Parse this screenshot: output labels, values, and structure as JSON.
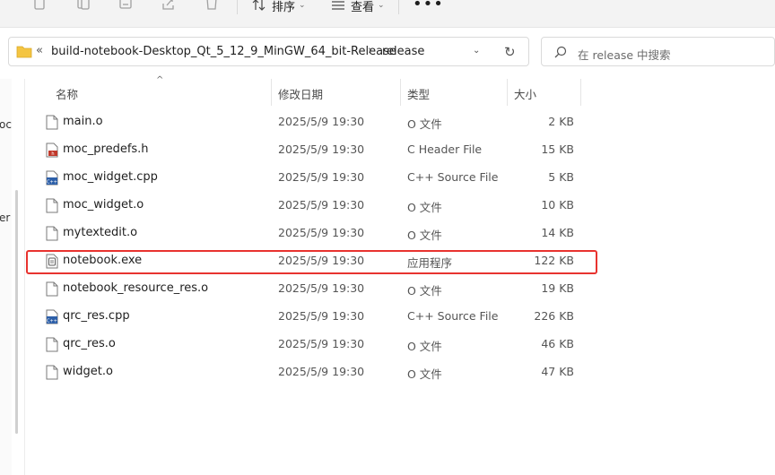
{
  "toolbar": {
    "sort_label": "排序",
    "view_label": "查看",
    "more_label": "•••"
  },
  "address": {
    "chevrons": "«",
    "folder": "build-notebook-Desktop_Qt_5_12_9_MinGW_64_bit-Release",
    "separator": "›",
    "current": "release"
  },
  "search": {
    "placeholder": "在 release 中搜索"
  },
  "left_pane": {
    "fragment_1": "oc",
    "fragment_2": "er"
  },
  "columns": {
    "name": "名称",
    "date": "修改日期",
    "type": "类型",
    "size": "大小"
  },
  "files": [
    {
      "name": "main.o",
      "date": "2025/5/9 19:30",
      "type": "O 文件",
      "size": "2 KB",
      "icon": "generic-file-icon"
    },
    {
      "name": "moc_predefs.h",
      "date": "2025/5/9 19:30",
      "type": "C Header File",
      "size": "15 KB",
      "icon": "c-header-file-icon"
    },
    {
      "name": "moc_widget.cpp",
      "date": "2025/5/9 19:30",
      "type": "C++ Source File",
      "size": "5 KB",
      "icon": "cpp-source-file-icon"
    },
    {
      "name": "moc_widget.o",
      "date": "2025/5/9 19:30",
      "type": "O 文件",
      "size": "10 KB",
      "icon": "generic-file-icon"
    },
    {
      "name": "mytextedit.o",
      "date": "2025/5/9 19:30",
      "type": "O 文件",
      "size": "14 KB",
      "icon": "generic-file-icon"
    },
    {
      "name": "notebook.exe",
      "date": "2025/5/9 19:30",
      "type": "应用程序",
      "size": "122 KB",
      "icon": "exe-file-icon"
    },
    {
      "name": "notebook_resource_res.o",
      "date": "2025/5/9 19:30",
      "type": "O 文件",
      "size": "19 KB",
      "icon": "generic-file-icon"
    },
    {
      "name": "qrc_res.cpp",
      "date": "2025/5/9 19:30",
      "type": "C++ Source File",
      "size": "226 KB",
      "icon": "cpp-source-file-icon"
    },
    {
      "name": "qrc_res.o",
      "date": "2025/5/9 19:30",
      "type": "O 文件",
      "size": "46 KB",
      "icon": "generic-file-icon"
    },
    {
      "name": "widget.o",
      "date": "2025/5/9 19:30",
      "type": "O 文件",
      "size": "47 KB",
      "icon": "generic-file-icon"
    }
  ],
  "colors": {
    "highlight": "#e8332f",
    "folder": "#f4c542",
    "cpp_icon": "#2d5fa8",
    "header_icon": "#c0392b"
  }
}
